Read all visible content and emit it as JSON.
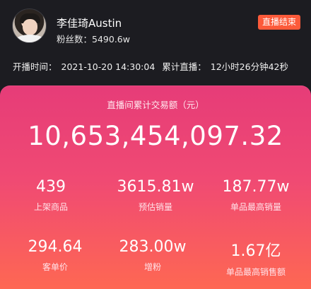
{
  "header": {
    "streamer_name": "李佳琦Austin",
    "fans_label": "粉丝数：",
    "fans_value": "5490.6w",
    "status_badge": "直播结束",
    "start_time_label": "开播时间：",
    "start_time_value": "2021-10-20 14:30:04",
    "duration_label": "累计直播：",
    "duration_value": "12小时26分钟42秒"
  },
  "summary": {
    "title": "直播间累计交易额（元）",
    "total_value": "10,653,454,097.32"
  },
  "stats": [
    {
      "value": "439",
      "label": "上架商品"
    },
    {
      "value": "3615.81w",
      "label": "预估销量"
    },
    {
      "value": "187.77w",
      "label": "单品最高销量"
    },
    {
      "value": "294.64",
      "label": "客单价"
    },
    {
      "value": "283.00w",
      "label": "增粉"
    },
    {
      "value": "1.67亿",
      "label": "单品最高销售额"
    }
  ],
  "colors": {
    "badge": "#fc5a3a",
    "card_top": "#e63c78",
    "card_bottom": "#ff6a50",
    "background": "#1c1c21"
  }
}
